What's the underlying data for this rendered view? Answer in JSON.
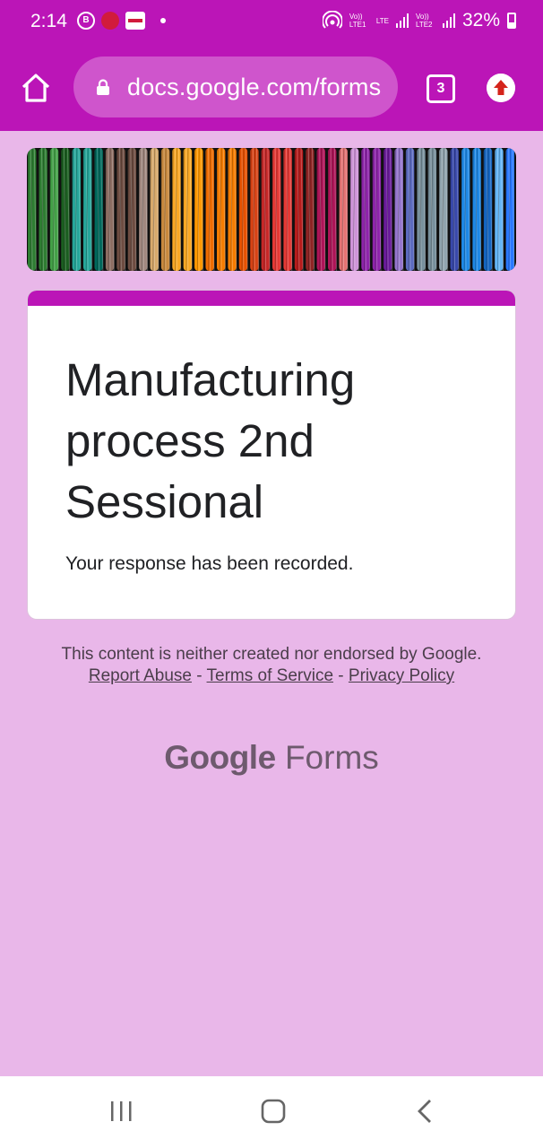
{
  "status_bar": {
    "time": "2:14",
    "battery": "32%",
    "sim1": "Vo)) LTE1",
    "sim2": "Vo)) LTE2",
    "network": "LTE"
  },
  "browser": {
    "url": "docs.google.com/forms",
    "tab_count": "3"
  },
  "form": {
    "title": "Manufacturing process 2nd Sessional",
    "confirmation": "Your response has been recorded.",
    "accent_color": "#bb15b7",
    "background_color": "#e9b7e9"
  },
  "footer": {
    "disclaimer": "This content is neither created nor endorsed by Google.",
    "report_abuse": "Report Abuse",
    "separator": "-",
    "terms": "Terms of Service",
    "privacy": "Privacy Policy"
  },
  "brand": {
    "google": "Google",
    "forms": "Forms"
  }
}
